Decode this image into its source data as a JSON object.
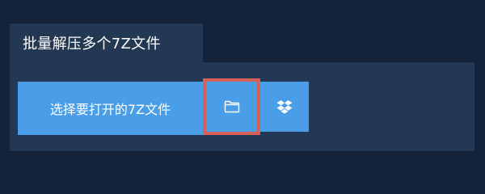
{
  "tab": {
    "title": "批量解压多个7Z文件"
  },
  "actions": {
    "select_button_label": "选择要打开的7Z文件",
    "folder_icon": "folder-icon",
    "dropbox_icon": "dropbox-icon"
  },
  "colors": {
    "background": "#13233a",
    "panel": "#233852",
    "button": "#4a9ee8",
    "highlight_border": "#d9605a"
  }
}
